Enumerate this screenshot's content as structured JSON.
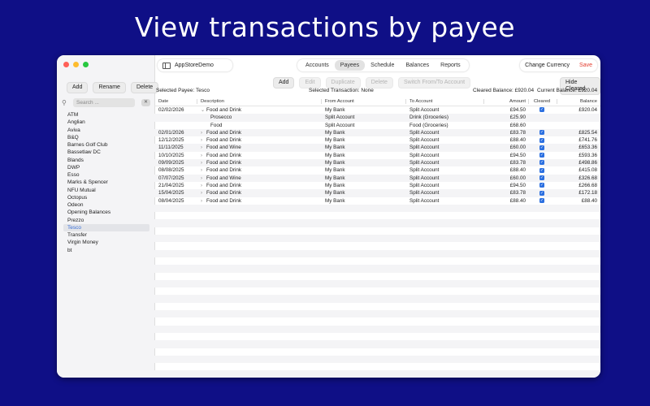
{
  "hero_title": "View transactions by payee",
  "colors": {
    "background": "#0f0f86",
    "accent": "#2b6fe0",
    "save": "#e33b2e"
  },
  "sidebar": {
    "buttons": [
      "Add",
      "Rename",
      "Delete"
    ],
    "search_placeholder": "Search ...",
    "payees": [
      "ATM",
      "Anglian",
      "Aviva",
      "B&Q",
      "Barnes Golf Club",
      "Bassetlaw DC",
      "Blands",
      "DWP",
      "Esso",
      "Marks & Spencer",
      "NFU Mutual",
      "Octopus",
      "Odeon",
      "Opening Balances",
      "Prezzo",
      "Tesco",
      "Transfer",
      "Virgin Money",
      "bt"
    ],
    "selected": "Tesco"
  },
  "toolbar": {
    "doc_title": "AppStoreDemo",
    "tabs": [
      "Accounts",
      "Payees",
      "Schedule",
      "Balances",
      "Reports"
    ],
    "active_tab": "Payees",
    "currency_label": "Change Currency",
    "save_label": "Save"
  },
  "actions": {
    "buttons": [
      {
        "label": "Add",
        "enabled": true
      },
      {
        "label": "Edit",
        "enabled": false
      },
      {
        "label": "Duplicate",
        "enabled": false
      },
      {
        "label": "Delete",
        "enabled": false
      },
      {
        "label": "Switch From/To Account",
        "enabled": false
      }
    ],
    "hide_cleared": "Hide Cleared"
  },
  "info": {
    "selected_payee": "Selected Payee:  Tesco",
    "selected_transaction": "Selected Transaction:  None",
    "cleared_balance": "Cleared Balance:  £920.04",
    "current_balance": "Current Balance:  £920.04"
  },
  "table": {
    "columns": [
      "Date",
      "Description",
      "From Account",
      "To Account",
      "Amount",
      "Cleared",
      "Balance"
    ],
    "rows": [
      {
        "date": "02/02/2026",
        "chevron": "down",
        "desc": "Food and Drink",
        "from": "My Bank",
        "to": "Split Account",
        "amount": "£94.50",
        "cleared": true,
        "balance": "£920.04"
      },
      {
        "date": "",
        "chevron": "none",
        "desc": "Prosecco",
        "from": "Split Account",
        "to": "Drink (Groceries)",
        "amount": "£25.90",
        "cleared": false,
        "balance": ""
      },
      {
        "date": "",
        "chevron": "none",
        "desc": "Food",
        "from": "Split Account",
        "to": "Food (Groceries)",
        "amount": "£68.60",
        "cleared": false,
        "balance": ""
      },
      {
        "date": "02/01/2026",
        "chevron": "right",
        "desc": "Food and Drink",
        "from": "My Bank",
        "to": "Split Account",
        "amount": "£83.78",
        "cleared": true,
        "balance": "£825.54"
      },
      {
        "date": "12/12/2025",
        "chevron": "right",
        "desc": "Food and Drink",
        "from": "My Bank",
        "to": "Split Account",
        "amount": "£88.40",
        "cleared": true,
        "balance": "£741.76"
      },
      {
        "date": "11/11/2025",
        "chevron": "right",
        "desc": "Food and Wine",
        "from": "My Bank",
        "to": "Split Account",
        "amount": "£60.00",
        "cleared": true,
        "balance": "£653.36"
      },
      {
        "date": "10/10/2025",
        "chevron": "right",
        "desc": "Food and Drink",
        "from": "My Bank",
        "to": "Split Account",
        "amount": "£94.50",
        "cleared": true,
        "balance": "£593.36"
      },
      {
        "date": "09/09/2025",
        "chevron": "right",
        "desc": "Food and Drink",
        "from": "My Bank",
        "to": "Split Account",
        "amount": "£83.78",
        "cleared": true,
        "balance": "£498.86"
      },
      {
        "date": "08/08/2025",
        "chevron": "right",
        "desc": "Food and Drink",
        "from": "My Bank",
        "to": "Split Account",
        "amount": "£88.40",
        "cleared": true,
        "balance": "£415.08"
      },
      {
        "date": "07/07/2025",
        "chevron": "right",
        "desc": "Food and Wine",
        "from": "My Bank",
        "to": "Split Account",
        "amount": "£60.00",
        "cleared": true,
        "balance": "£326.68"
      },
      {
        "date": "21/04/2025",
        "chevron": "right",
        "desc": "Food and Drink",
        "from": "My Bank",
        "to": "Split Account",
        "amount": "£94.50",
        "cleared": true,
        "balance": "£266.68"
      },
      {
        "date": "15/04/2025",
        "chevron": "right",
        "desc": "Food and Drink",
        "from": "My Bank",
        "to": "Split Account",
        "amount": "£83.78",
        "cleared": true,
        "balance": "£172.18"
      },
      {
        "date": "08/04/2025",
        "chevron": "right",
        "desc": "Food and Drink",
        "from": "My Bank",
        "to": "Split Account",
        "amount": "£88.40",
        "cleared": true,
        "balance": "£88.40"
      }
    ]
  }
}
